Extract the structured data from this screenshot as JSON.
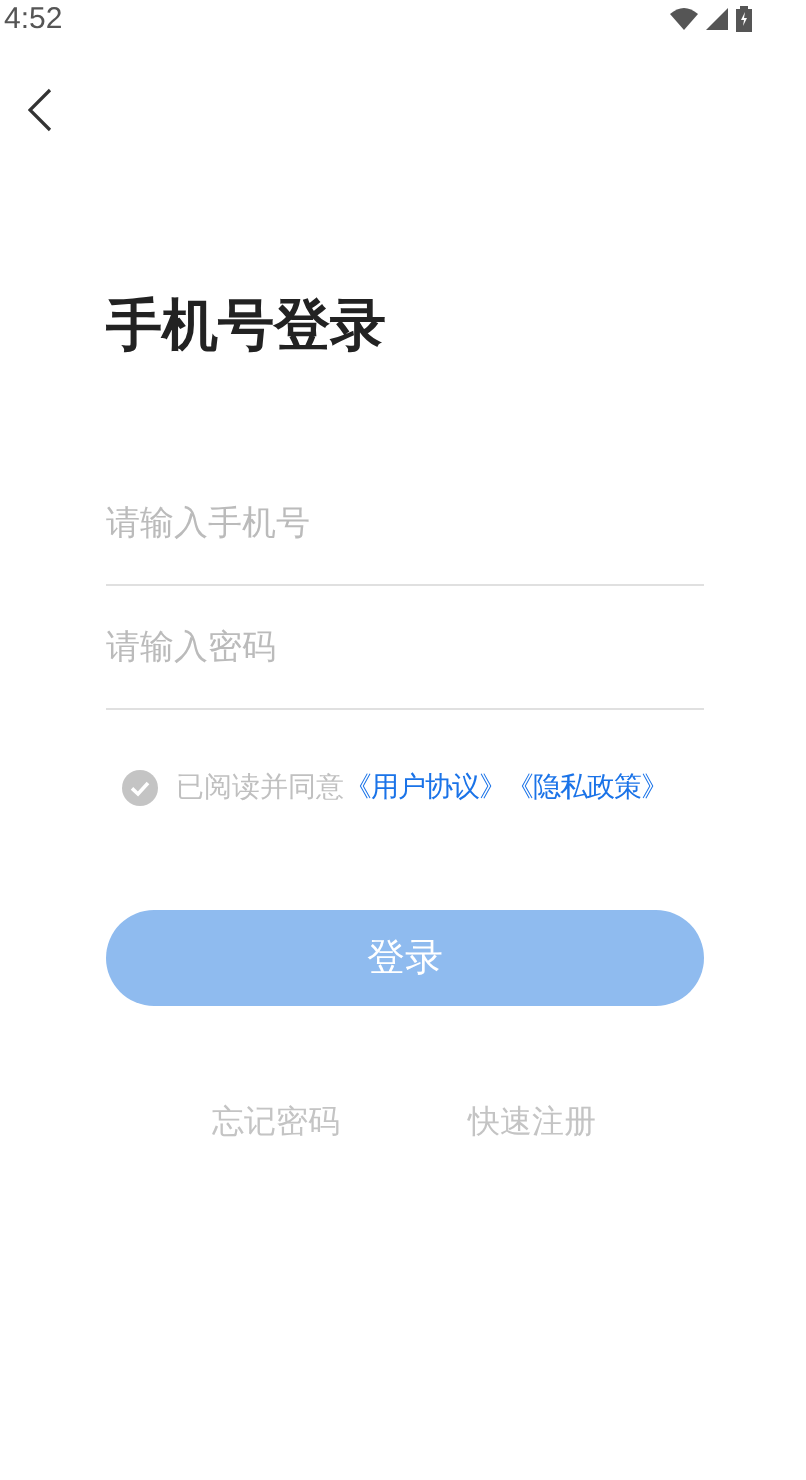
{
  "status_bar": {
    "time": "4:52"
  },
  "title": "手机号登录",
  "fields": [
    {
      "placeholder": "请输入手机号"
    },
    {
      "placeholder": "请输入密码"
    }
  ],
  "agreement": {
    "checked": false,
    "text": "已阅读并同意",
    "links": [
      "《用户协议》",
      "《隐私政策》"
    ]
  },
  "login_button": {
    "label": "登录",
    "disabled": true
  },
  "footer_links": [
    "忘记密码",
    "快速注册"
  ]
}
